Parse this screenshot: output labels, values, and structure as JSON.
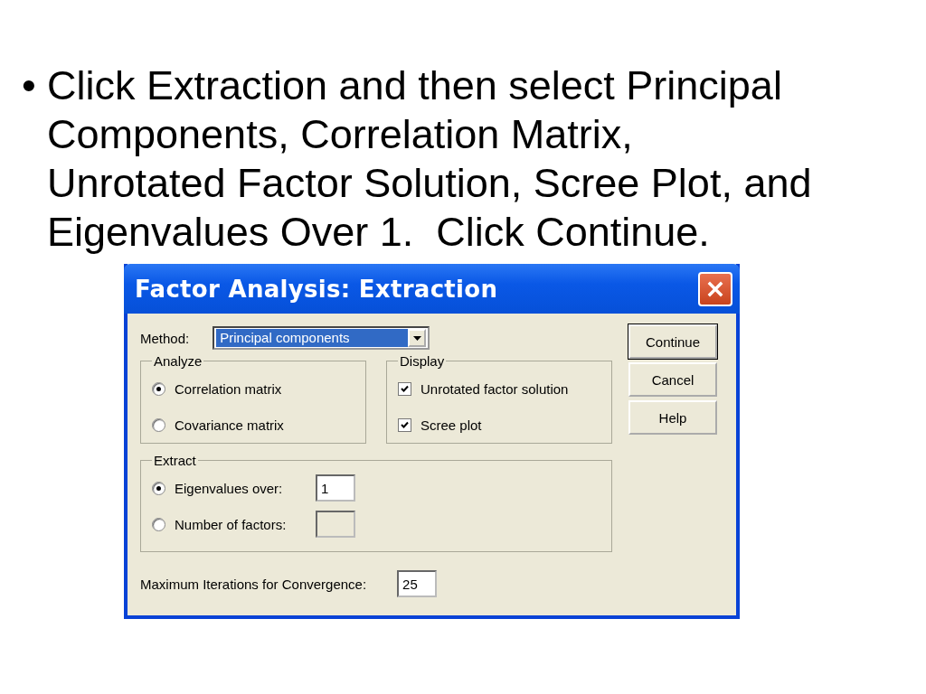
{
  "slide": {
    "bullet": "•",
    "text": "Click Extraction and then select Principal Components, Correlation Matrix, Unrotated Factor Solution, Scree Plot, and Eigenvalues Over 1.  Click Continue."
  },
  "dialog": {
    "title": "Factor Analysis: Extraction",
    "method": {
      "label": "Method:",
      "value": "Principal components"
    },
    "analyze": {
      "title": "Analyze",
      "options": [
        {
          "label": "Correlation matrix",
          "selected": true
        },
        {
          "label": "Covariance matrix",
          "selected": false
        }
      ]
    },
    "display": {
      "title": "Display",
      "options": [
        {
          "label": "Unrotated factor solution",
          "checked": true
        },
        {
          "label": "Scree plot",
          "checked": true
        }
      ]
    },
    "extract": {
      "title": "Extract",
      "options": [
        {
          "label": "Eigenvalues over:",
          "selected": true,
          "value": "1",
          "disabled": false
        },
        {
          "label": "Number of factors:",
          "selected": false,
          "disabled": true
        }
      ]
    },
    "iterations": {
      "label": "Maximum Iterations for Convergence:",
      "value": "25"
    },
    "buttons": [
      {
        "label": "Continue",
        "default": true
      },
      {
        "label": "Cancel",
        "default": false
      },
      {
        "label": "Help",
        "default": false
      }
    ]
  }
}
